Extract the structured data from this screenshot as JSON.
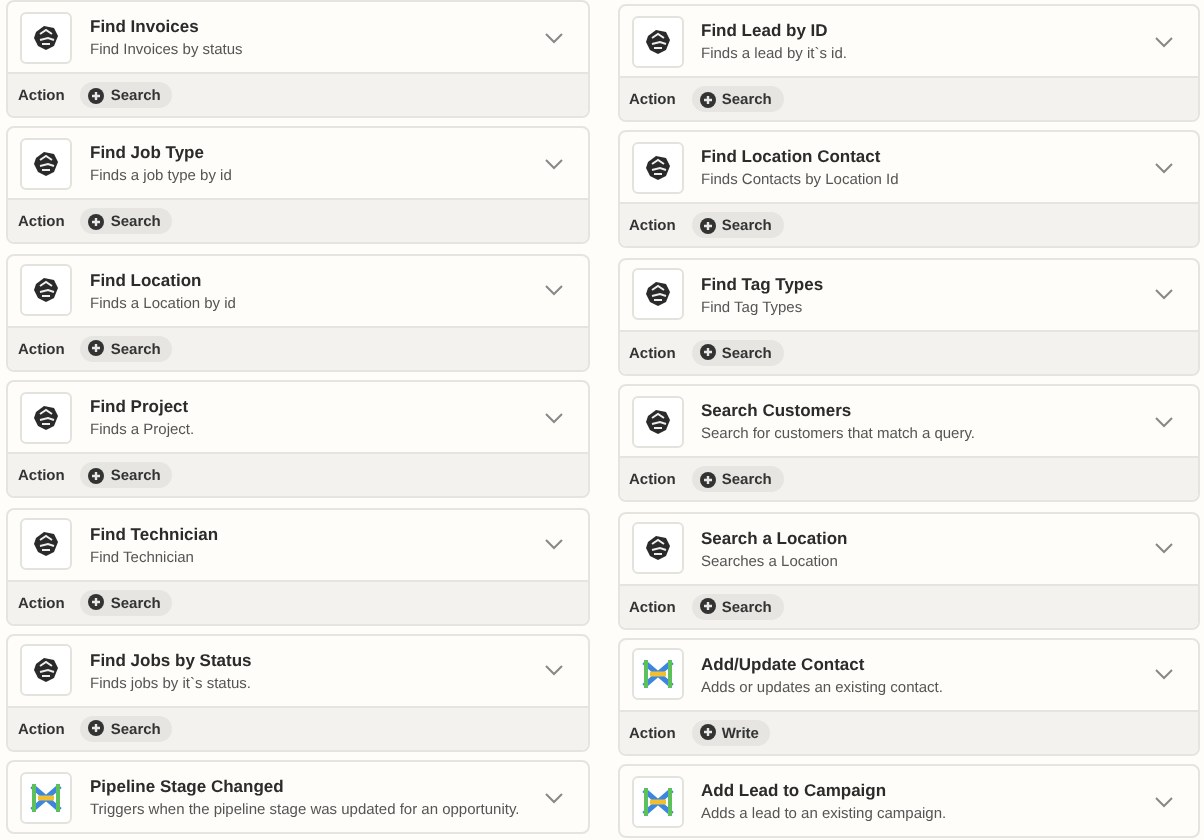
{
  "columns": [
    {
      "cards": [
        {
          "kind": "blob",
          "title": "Find Invoices",
          "description": "Find Invoices by status",
          "footer": {
            "label": "Action",
            "badge": "Search"
          }
        },
        {
          "kind": "blob",
          "title": "Find Job Type",
          "description": "Finds a job type by id",
          "footer": {
            "label": "Action",
            "badge": "Search"
          }
        },
        {
          "kind": "blob",
          "title": "Find Location",
          "description": "Finds a Location by id",
          "footer": {
            "label": "Action",
            "badge": "Search"
          }
        },
        {
          "kind": "blob",
          "title": "Find Project",
          "description": "Finds a Project.",
          "footer": {
            "label": "Action",
            "badge": "Search"
          }
        },
        {
          "kind": "blob",
          "title": "Find Technician",
          "description": "Find Technician",
          "footer": {
            "label": "Action",
            "badge": "Search"
          }
        },
        {
          "kind": "blob",
          "title": "Find Jobs by Status",
          "description": "Finds jobs by it`s status.",
          "footer": {
            "label": "Action",
            "badge": "Search"
          }
        },
        {
          "kind": "grid",
          "title": "Pipeline Stage Changed",
          "description": "Triggers when the pipeline stage was updated for an opportunity."
        }
      ]
    },
    {
      "cards": [
        {
          "kind": "blob",
          "title": "Find Lead by ID",
          "description": "Finds a lead by it`s id.",
          "footer": {
            "label": "Action",
            "badge": "Search"
          }
        },
        {
          "kind": "blob",
          "title": "Find Location Contact",
          "description": "Finds Contacts by Location Id",
          "footer": {
            "label": "Action",
            "badge": "Search"
          }
        },
        {
          "kind": "blob",
          "title": "Find Tag Types",
          "description": "Find Tag Types",
          "footer": {
            "label": "Action",
            "badge": "Search"
          }
        },
        {
          "kind": "blob",
          "title": "Search Customers",
          "description": "Search for customers that match a query.",
          "footer": {
            "label": "Action",
            "badge": "Search"
          }
        },
        {
          "kind": "blob",
          "title": "Search a Location",
          "description": "Searches a Location",
          "footer": {
            "label": "Action",
            "badge": "Search"
          }
        },
        {
          "kind": "grid",
          "title": "Add/Update Contact",
          "description": "Adds or updates an existing contact.",
          "footer": {
            "label": "Action",
            "badge": "Write"
          }
        },
        {
          "kind": "grid",
          "title": "Add Lead to Campaign",
          "description": "Adds a lead to an existing campaign."
        }
      ]
    }
  ]
}
